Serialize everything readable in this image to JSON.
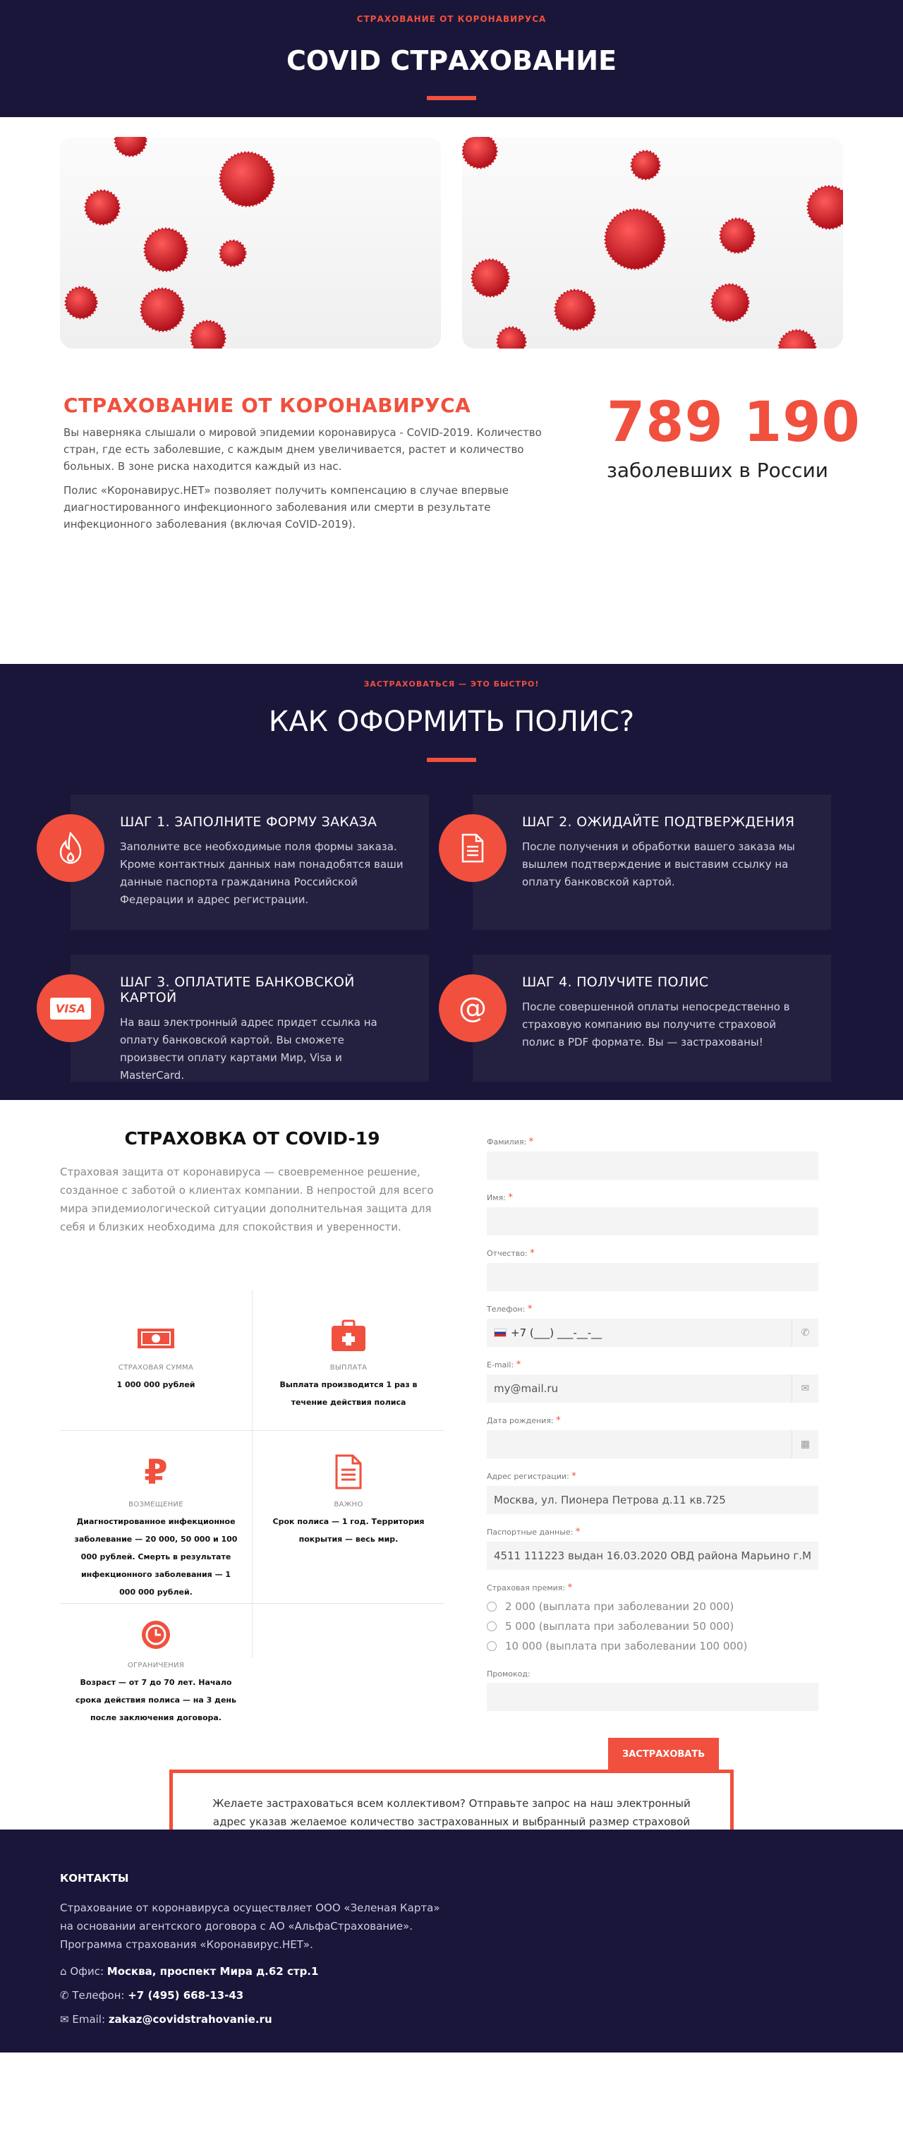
{
  "hero": {
    "supertitle": "СТРАХОВАНИЕ ОТ КОРОНАВИРУСА",
    "title": "COVID СТРАХОВАНИЕ"
  },
  "info": {
    "heading": "СТРАХОВАНИЕ ОТ КОРОНАВИРУСА",
    "p1": "Вы наверняка слышали о мировой эпидемии коронавируса - CoVID-2019. Количество стран, где есть заболевшие, с каждым днем увеличивается, растет и количество больных. В зоне риска находится каждый из нас.",
    "p2": "Полис «Коронавирус.НЕТ» позволяет получить компенсацию в случае впервые диагностированного инфекционного заболевания или смерти в результате инфекционного заболевания (включая CoVID-2019).",
    "count": "789 190",
    "count_label": "заболевших в России"
  },
  "howto": {
    "supertitle": "ЗАСТРАХОВАТЬСЯ — ЭТО БЫСТРО!",
    "title": "КАК ОФОРМИТЬ ПОЛИС?",
    "steps": [
      {
        "title": "ШАГ 1. ЗАПОЛНИТЕ ФОРМУ ЗАКАЗА",
        "text": "Заполните все необходимые поля формы заказа. Кроме контактных данных нам понадобятся ваши данные паспорта гражданина Российской Федерации и адрес регистрации.",
        "icon": "flame-icon"
      },
      {
        "title": "ШАГ 2. ОЖИДАЙТЕ ПОДТВЕРЖДЕНИЯ",
        "text": "После получения и обработки вашего заказа мы вышлем подтверждение и выставим ссылку на оплату банковской картой.",
        "icon": "document-icon"
      },
      {
        "title": "ШАГ 3. ОПЛАТИТЕ БАНКОВСКОЙ КАРТОЙ",
        "text": "На ваш электронный адрес придет ссылка на оплату банковской картой. Вы сможете произвести оплату картами Мир, Visa и MasterCard.",
        "icon": "visa-icon",
        "icon_text": "VISA"
      },
      {
        "title": "ШАГ 4. ПОЛУЧИТЕ ПОЛИС",
        "text": "После совершенной оплаты непосредственно в страховую компанию вы получите страховой полис в PDF формате. Вы — застрахованы!",
        "icon": "at-icon",
        "icon_text": "@"
      }
    ]
  },
  "product": {
    "title": "СТРАХОВКА ОТ COVID-19",
    "desc": "Страховая защита от коронавируса — своевременное решение, созданное с заботой о клиентах компании. В непростой для всего мира эпидемиологической ситуации дополнительная защита для себя и близких необходима для спокойствия и уверенности.",
    "features": [
      {
        "label": "СТРАХОВАЯ СУММА",
        "value": "1 000 000 рублей",
        "icon": "money-icon"
      },
      {
        "label": "ВЫПЛАТА",
        "value": "Выплата производится 1 раз в течение действия полиса",
        "icon": "medkit-icon"
      },
      {
        "label": "ВОЗМЕЩЕНИЕ",
        "value": "Диагностированное инфекционное заболевание — 20 000, 50 000 и 100 000 рублей. Смерть в результате инфекционного заболевания — 1 000 000 рублей.",
        "icon": "ruble-icon",
        "icon_text": "₽"
      },
      {
        "label": "ВАЖНО",
        "value": "Срок полиса — 1 год. Территория покрытия — весь мир.",
        "icon": "document-icon"
      },
      {
        "label": "ОГРАНИЧЕНИЯ",
        "value": "Возраст — от 7 до 70 лет. Начало срока действия полиса — на 3 день после заключения договора.",
        "icon": "clock-icon"
      }
    ]
  },
  "form": {
    "surname": {
      "label": "Фамилия:",
      "value": ""
    },
    "name": {
      "label": "Имя:",
      "value": ""
    },
    "patronymic": {
      "label": "Отчество:",
      "value": ""
    },
    "phone": {
      "label": "Телефон:",
      "value": "+7 (___) ___-__-__"
    },
    "email": {
      "label": "E-mail:",
      "value": "my@mail.ru"
    },
    "birth": {
      "label": "Дата рождения:",
      "value": ""
    },
    "address": {
      "label": "Адрес регистрации:",
      "value": "Москва, ул. Пионера Петрова д.11 кв.725"
    },
    "passport": {
      "label": "Паспортные данные:",
      "value": "4511 111223 выдан 16.03.2020 ОВД района Марьино г.М"
    },
    "premium": {
      "label": "Страховая премия:",
      "options": [
        "2 000 (выплата при заболевании 20 000)",
        "5 000 (выплата при заболевании 50 000)",
        "10 000 (выплата при заболевании 100 000)"
      ]
    },
    "promo": {
      "label": "Промокод:",
      "value": ""
    },
    "submit": "ЗАСТРАХОВАТЬ"
  },
  "group_offer": "Желаете застраховаться всем коллективом? Отправьте запрос на наш электронный адрес указав желаемое количество застрахованных и выбранный размер страховой премии. Мы подготовим индивидуальное предложение каждому вашему сотруднику!",
  "footer": {
    "heading": "КОНТАКТЫ",
    "text": "Страхование от коронавируса осуществляет ООО «Зеленая Карта» на основании агентского договора с АО «АльфаСтрахование». Программа страхования «Коронавирус.НЕТ».",
    "office_label": "Офис:",
    "office": "Москва, проспект Мира д.62 стр.1",
    "phone_label": "Телефон:",
    "phone": "+7 (495) 668-13-43",
    "email_label": "Email:",
    "email": "zakaz@covidstrahovanie.ru"
  },
  "colors": {
    "accent": "#f0503d",
    "dark": "#19163a",
    "card": "#24203f"
  }
}
